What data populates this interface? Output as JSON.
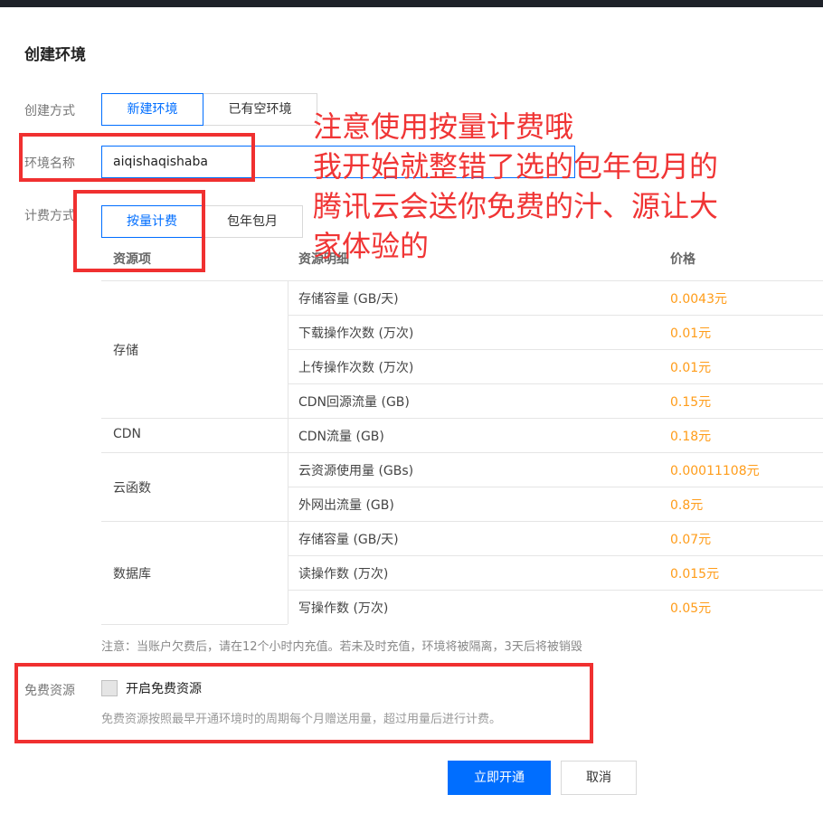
{
  "dialog": {
    "title": "创建环境"
  },
  "create_method": {
    "label": "创建方式",
    "options": [
      "新建环境",
      "已有空环境"
    ],
    "selected": "新建环境"
  },
  "env_name": {
    "label": "环境名称",
    "value": "aiqishaqishaba"
  },
  "billing": {
    "label": "计费方式",
    "options": [
      "按量计费",
      "包年包月"
    ],
    "selected": "按量计费"
  },
  "pricing_table": {
    "headers": [
      "资源项",
      "资源明细",
      "价格"
    ],
    "groups": [
      {
        "name": "存储",
        "items": [
          {
            "detail": "存储容量 (GB/天)",
            "price": "0.0043元"
          },
          {
            "detail": "下载操作次数 (万次)",
            "price": "0.01元"
          },
          {
            "detail": "上传操作次数 (万次)",
            "price": "0.01元"
          },
          {
            "detail": "CDN回源流量 (GB)",
            "price": "0.15元"
          }
        ]
      },
      {
        "name": "CDN",
        "items": [
          {
            "detail": "CDN流量 (GB)",
            "price": "0.18元"
          }
        ]
      },
      {
        "name": "云函数",
        "items": [
          {
            "detail": "云资源使用量 (GBs)",
            "price": "0.00011108元"
          },
          {
            "detail": "外网出流量 (GB)",
            "price": "0.8元"
          }
        ]
      },
      {
        "name": "数据库",
        "items": [
          {
            "detail": "存储容量 (GB/天)",
            "price": "0.07元"
          },
          {
            "detail": "读操作数 (万次)",
            "price": "0.015元"
          },
          {
            "detail": "写操作数 (万次)",
            "price": "0.05元"
          }
        ]
      }
    ]
  },
  "note": "注意：当账户欠费后，请在12个小时内充值。若未及时充值，环境将被隔离，3天后将被销毁",
  "free_resource": {
    "label": "免费资源",
    "checkbox_label": "开启免费资源",
    "checked": false,
    "description": "免费资源按照最早开通环境时的周期每个月赠送用量，超过用量后进行计费。"
  },
  "buttons": {
    "confirm": "立即开通",
    "cancel": "取消"
  },
  "annotation": {
    "lines": [
      "注意使用按量计费哦",
      "我开始就整错了选的包年包月的",
      "腾讯云会送你免费的汁、源让大",
      "家体验的"
    ],
    "color": "#f03535"
  },
  "colors": {
    "accent": "#006eff",
    "price": "#ff9c19",
    "annotation_box": "#f03030"
  }
}
